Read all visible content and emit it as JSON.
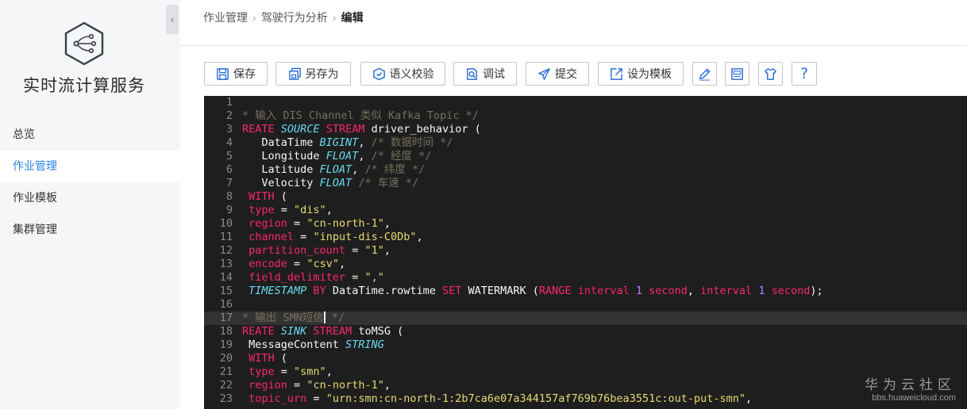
{
  "sidebar": {
    "brand": "实时流计算服务",
    "logo_icon": "network-hexagon-icon",
    "collapse_icon": "chevron-left-icon",
    "collapse_glyph": "‹",
    "items": [
      {
        "label": "总览",
        "active": false
      },
      {
        "label": "作业管理",
        "active": true
      },
      {
        "label": "作业模板",
        "active": false
      },
      {
        "label": "集群管理",
        "active": false
      }
    ]
  },
  "header": {
    "breadcrumb": [
      "作业管理",
      "驾驶行为分析",
      "编辑"
    ],
    "separator": "›"
  },
  "toolbar": {
    "save": "保存",
    "save_as": "另存为",
    "validate": "语义校验",
    "debug": "调试",
    "submit": "提交",
    "set_template": "设为模板",
    "edit_icon": "pencil-icon",
    "settings_icon": "param-panel-icon",
    "theme_icon": "shirt-icon",
    "help_icon": "question-icon",
    "help_glyph": "?"
  },
  "editor": {
    "theme": {
      "background": "#1e1e1e",
      "keyword": "#f92672",
      "type": "#66d9ef",
      "string": "#e6db74",
      "comment": "#75715e",
      "number": "#ae81ff"
    },
    "lines": [
      {
        "n": "1",
        "tokens": []
      },
      {
        "n": "2",
        "tokens": [
          [
            "com",
            "* 输入 DIS Channel 类似 Kafka Topic */"
          ]
        ]
      },
      {
        "n": "3",
        "tokens": [
          [
            "kw",
            "REATE "
          ],
          [
            "type",
            "SOURCE "
          ],
          [
            "kw",
            "STREAM "
          ],
          [
            "plain",
            "driver_behavior ("
          ]
        ]
      },
      {
        "n": "4",
        "tokens": [
          [
            "plain",
            "   DataTime "
          ],
          [
            "type",
            "BIGINT"
          ],
          [
            "plain",
            ", "
          ],
          [
            "com",
            "/* 数据时间 */"
          ]
        ]
      },
      {
        "n": "5",
        "tokens": [
          [
            "plain",
            "   Longitude "
          ],
          [
            "type",
            "FLOAT"
          ],
          [
            "plain",
            ", "
          ],
          [
            "com",
            "/* 经度 */"
          ]
        ]
      },
      {
        "n": "6",
        "tokens": [
          [
            "plain",
            "   Latitude "
          ],
          [
            "type",
            "FLOAT"
          ],
          [
            "plain",
            ", "
          ],
          [
            "com",
            "/* 纬度 */"
          ]
        ]
      },
      {
        "n": "7",
        "tokens": [
          [
            "plain",
            "   Velocity "
          ],
          [
            "type",
            "FLOAT "
          ],
          [
            "com",
            "/* 车速 */"
          ]
        ]
      },
      {
        "n": "8",
        "tokens": [
          [
            "plain",
            " "
          ],
          [
            "kw",
            "WITH "
          ],
          [
            "plain",
            "("
          ]
        ]
      },
      {
        "n": "9",
        "tokens": [
          [
            "plain",
            " "
          ],
          [
            "kw",
            "type "
          ],
          [
            "plain",
            "= "
          ],
          [
            "str",
            "\"dis\""
          ],
          [
            "plain",
            ","
          ]
        ]
      },
      {
        "n": "10",
        "tokens": [
          [
            "plain",
            " "
          ],
          [
            "kw",
            "region "
          ],
          [
            "plain",
            "= "
          ],
          [
            "str",
            "\"cn-north-1\""
          ],
          [
            "plain",
            ","
          ]
        ]
      },
      {
        "n": "11",
        "tokens": [
          [
            "plain",
            " "
          ],
          [
            "kw",
            "channel "
          ],
          [
            "plain",
            "= "
          ],
          [
            "str",
            "\"input-dis-C0Db\""
          ],
          [
            "plain",
            ","
          ]
        ]
      },
      {
        "n": "12",
        "tokens": [
          [
            "plain",
            " "
          ],
          [
            "kw",
            "partition_count "
          ],
          [
            "plain",
            "= "
          ],
          [
            "str",
            "\"1\""
          ],
          [
            "plain",
            ","
          ]
        ]
      },
      {
        "n": "13",
        "tokens": [
          [
            "plain",
            " "
          ],
          [
            "kw",
            "encode "
          ],
          [
            "plain",
            "= "
          ],
          [
            "str",
            "\"csv\""
          ],
          [
            "plain",
            ","
          ]
        ]
      },
      {
        "n": "14",
        "tokens": [
          [
            "plain",
            " "
          ],
          [
            "kw",
            "field_delimiter "
          ],
          [
            "plain",
            "= "
          ],
          [
            "str",
            "\",\""
          ]
        ]
      },
      {
        "n": "15",
        "tokens": [
          [
            "plain",
            " "
          ],
          [
            "type",
            "TIMESTAMP "
          ],
          [
            "kw",
            "BY "
          ],
          [
            "plain",
            "DataTime.rowtime "
          ],
          [
            "kw",
            "SET "
          ],
          [
            "plain",
            "WATERMARK ("
          ],
          [
            "kw",
            "RANGE "
          ],
          [
            "kw",
            "interval "
          ],
          [
            "num",
            "1 "
          ],
          [
            "kw",
            "second"
          ],
          [
            "plain",
            ", "
          ],
          [
            "kw",
            "interval "
          ],
          [
            "num",
            "1 "
          ],
          [
            "kw",
            "second"
          ],
          [
            "plain",
            ");"
          ]
        ]
      },
      {
        "n": "16",
        "tokens": []
      },
      {
        "n": "17",
        "active": true,
        "tokens": [
          [
            "com",
            "* 输出 SMN短信"
          ],
          [
            "cursor",
            ""
          ],
          [
            "com",
            " */"
          ]
        ]
      },
      {
        "n": "18",
        "tokens": [
          [
            "kw",
            "REATE "
          ],
          [
            "type",
            "SINK "
          ],
          [
            "kw",
            "STREAM "
          ],
          [
            "plain",
            "toMSG ("
          ]
        ]
      },
      {
        "n": "19",
        "tokens": [
          [
            "plain",
            " MessageContent "
          ],
          [
            "type",
            "STRING"
          ]
        ]
      },
      {
        "n": "20",
        "tokens": [
          [
            "plain",
            " "
          ],
          [
            "kw",
            "WITH "
          ],
          [
            "plain",
            "("
          ]
        ]
      },
      {
        "n": "21",
        "tokens": [
          [
            "plain",
            " "
          ],
          [
            "kw",
            "type "
          ],
          [
            "plain",
            "= "
          ],
          [
            "str",
            "\"smn\""
          ],
          [
            "plain",
            ","
          ]
        ]
      },
      {
        "n": "22",
        "tokens": [
          [
            "plain",
            " "
          ],
          [
            "kw",
            "region "
          ],
          [
            "plain",
            "= "
          ],
          [
            "str",
            "\"cn-north-1\""
          ],
          [
            "plain",
            ","
          ]
        ]
      },
      {
        "n": "23",
        "tokens": [
          [
            "plain",
            " "
          ],
          [
            "kw",
            "topic_urn "
          ],
          [
            "plain",
            "= "
          ],
          [
            "str",
            "\"urn:smn:cn-north-1:2b7ca6e07a344157af769b76bea3551c:out-put-smn\""
          ],
          [
            "plain",
            ","
          ]
        ]
      }
    ]
  },
  "watermark": {
    "line1": "华为云社区",
    "line2": "bbs.huaweicloud.com"
  }
}
